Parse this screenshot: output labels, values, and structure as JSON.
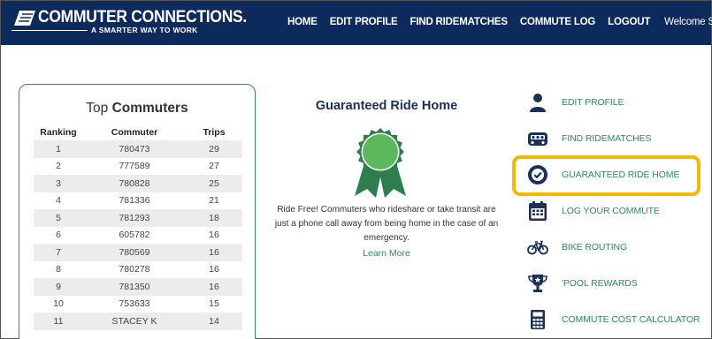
{
  "header": {
    "logo_title": "COMMUTER CONNECTIONS.",
    "logo_tagline": "A SMARTER WAY TO WORK",
    "nav": [
      "HOME",
      "EDIT PROFILE",
      "FIND RIDEMATCHES",
      "COMMUTE LOG",
      "LOGOUT"
    ],
    "welcome": "Welcome STACEY"
  },
  "leaderboard": {
    "title_plain": "Top ",
    "title_bold": "Commuters",
    "columns": [
      "Ranking",
      "Commuter",
      "Trips"
    ],
    "rows": [
      [
        "1",
        "780473",
        "29"
      ],
      [
        "2",
        "777589",
        "27"
      ],
      [
        "3",
        "780828",
        "25"
      ],
      [
        "4",
        "781336",
        "21"
      ],
      [
        "5",
        "781293",
        "18"
      ],
      [
        "6",
        "605782",
        "16"
      ],
      [
        "7",
        "780569",
        "16"
      ],
      [
        "8",
        "780278",
        "16"
      ],
      [
        "9",
        "781350",
        "16"
      ],
      [
        "10",
        "753633",
        "15"
      ],
      [
        "11",
        "STACEY K",
        "14"
      ]
    ]
  },
  "grh": {
    "title": "Guaranteed Ride Home",
    "description": "Ride Free! Commuters who rideshare or take transit are just a phone call away from being home in the case of an emergency.",
    "link": "Learn More"
  },
  "menu": [
    {
      "label": "EDIT PROFILE",
      "icon": "user-icon"
    },
    {
      "label": "FIND RIDEMATCHES",
      "icon": "carpool-icon"
    },
    {
      "label": "GUARANTEED RIDE HOME",
      "icon": "badge-check-icon"
    },
    {
      "label": "LOG YOUR COMMUTE",
      "icon": "calendar-icon"
    },
    {
      "label": "BIKE ROUTING",
      "icon": "bicycle-icon"
    },
    {
      "label": "'POOL REWARDS",
      "icon": "trophy-icon"
    },
    {
      "label": "COMMUTE COST CALCULATOR",
      "icon": "calculator-icon"
    }
  ],
  "colors": {
    "header_bg": "#0d2a5c",
    "accent_green": "#2e8b57",
    "ribbon_green": "#2e7d4f",
    "ribbon_inner": "#5cb85c",
    "icon_navy": "#1a2f5a",
    "highlight": "#f5b800"
  }
}
